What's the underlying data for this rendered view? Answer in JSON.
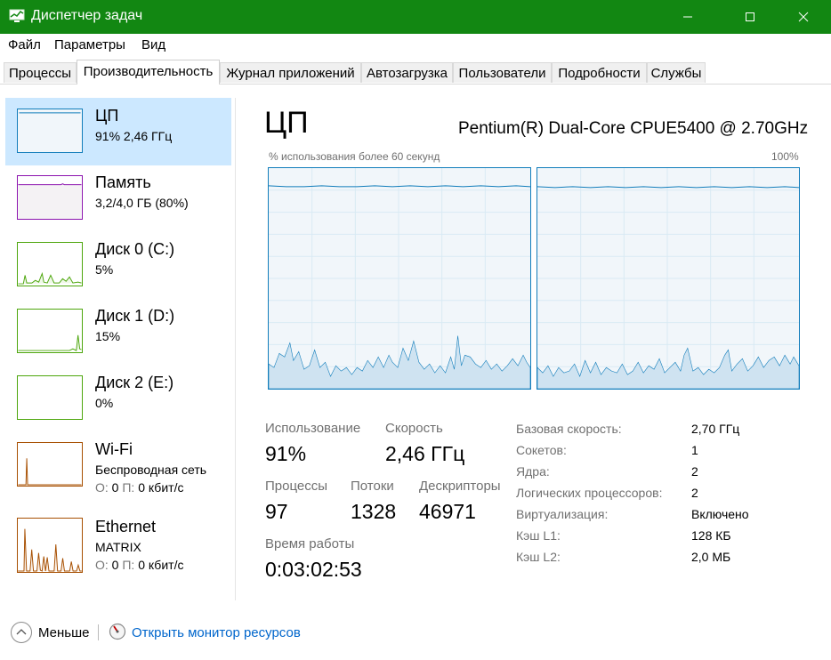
{
  "window": {
    "title": "Диспетчер задач"
  },
  "menu": [
    "Файл",
    "Параметры",
    "Вид"
  ],
  "tabs": [
    "Процессы",
    "Производительность",
    "Журнал приложений",
    "Автозагрузка",
    "Пользователи",
    "Подробности",
    "Службы"
  ],
  "active_tab": "Производительность",
  "sidebar": [
    {
      "title": "ЦП",
      "sub": "91% 2,46 ГГц"
    },
    {
      "title": "Память",
      "sub": "3,2/4,0 ГБ (80%)"
    },
    {
      "title": "Диск 0 (C:)",
      "sub": "5%"
    },
    {
      "title": "Диск 1 (D:)",
      "sub": "15%"
    },
    {
      "title": "Диск 2 (E:)",
      "sub": "0%"
    },
    {
      "title": "Wi-Fi",
      "sub": "Беспроводная сеть",
      "traffic": {
        "o": "О:",
        "o_val": "0",
        "p": "П:",
        "p_val": "0 кбит/с"
      }
    },
    {
      "title": "Ethernet",
      "sub": "MATRIX",
      "traffic": {
        "o": "О:",
        "o_val": "0",
        "p": "П:",
        "p_val": "0 кбит/с"
      }
    }
  ],
  "main": {
    "title": "ЦП",
    "cpu_model": "Pentium(R) Dual-Core CPUE5400 @ 2.70GHz",
    "graph_caption": "% использования более 60 секунд",
    "graph_max": "100%",
    "stats": {
      "usage_label": "Использование",
      "usage": "91%",
      "speed_label": "Скорость",
      "speed": "2,46 ГГц",
      "processes_label": "Процессы",
      "processes": "97",
      "threads_label": "Потоки",
      "threads": "1328",
      "handles_label": "Дескрипторы",
      "handles": "46971",
      "uptime_label": "Время работы",
      "uptime": "0:03:02:53"
    },
    "info": [
      {
        "label": "Базовая скорость:",
        "value": "2,70 ГГц"
      },
      {
        "label": "Сокетов:",
        "value": "1"
      },
      {
        "label": "Ядра:",
        "value": "2"
      },
      {
        "label": "Логических процессоров:",
        "value": "2"
      },
      {
        "label": "Виртуализация:",
        "value": "Включено"
      },
      {
        "label": "Кэш L1:",
        "value": "128 КБ"
      },
      {
        "label": "Кэш L2:",
        "value": "2,0 МБ"
      }
    ]
  },
  "footer": {
    "less": "Меньше",
    "resmon": "Открыть монитор ресурсов"
  },
  "colors": {
    "titlebar": "#128712",
    "cpu": "#117dbb",
    "memory": "#8b12ae",
    "disk": "#4da60c",
    "network": "#a74f01",
    "selected": "#cce8ff"
  }
}
